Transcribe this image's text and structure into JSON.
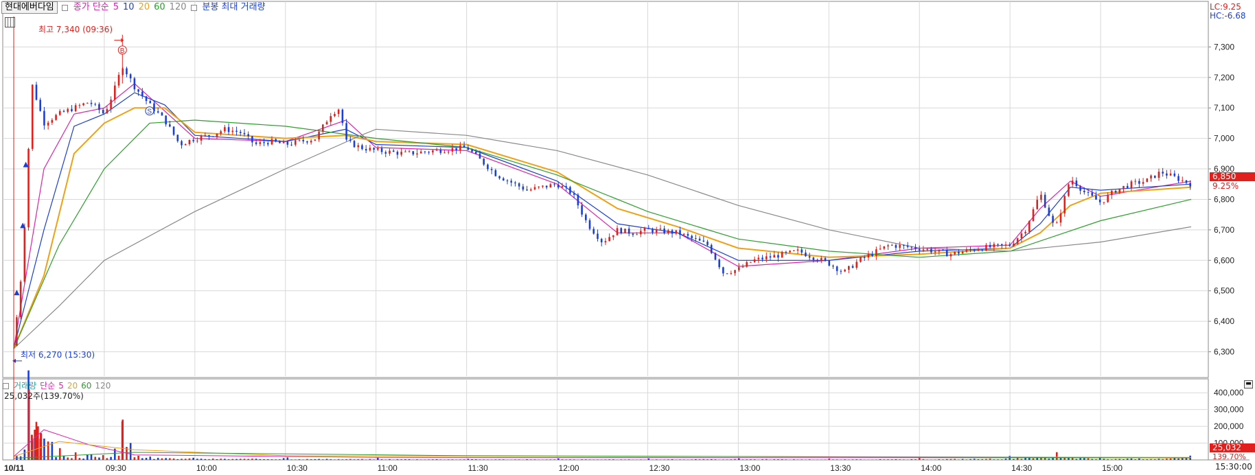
{
  "header": {
    "stock_name": "현대에버다임",
    "price_legend": {
      "label": "종가 단순",
      "ma": [
        "5",
        "10",
        "20",
        "60",
        "120"
      ]
    },
    "extra_legend": "분봉 최대 거래량",
    "lc": "LC:9.25",
    "hc": "HC:-6.68"
  },
  "annotations": {
    "high": "최고 7,340 (09:36)",
    "low": "최저 6,270 (15:30)",
    "buy_mark": "B",
    "sell_mark": "S"
  },
  "volume_header": {
    "label": "거래량",
    "legend": "단순",
    "ma": [
      "5",
      "20",
      "60",
      "120"
    ],
    "current": "25,032주(139.70%)"
  },
  "right_panel": {
    "current_price": "6,850",
    "current_change": "9.25%",
    "current_volume": "25,032",
    "volume_ratio": "139.70%",
    "last_time": "15:30:00"
  },
  "colors": {
    "up": "#e0201c",
    "down": "#1a3ed8",
    "ma5": "#e020b0",
    "ma10": "#1a3ed8",
    "ma20": "#f0a010",
    "ma60": "#2aa02a",
    "ma120": "#888888"
  },
  "chart_data": [
    {
      "type": "line",
      "x_ticks": [
        "10/11",
        "09:30",
        "10:00",
        "10:30",
        "11:00",
        "11:30",
        "12:00",
        "12:30",
        "13:00",
        "13:30",
        "14:00",
        "14:30",
        "15:00"
      ],
      "y_ticks": [
        "7,300",
        "7,200",
        "7,100",
        "7,000",
        "6,900",
        "6,800",
        "6,700",
        "6,600",
        "6,500",
        "6,400",
        "6,300"
      ],
      "ylim": [
        6220,
        7400
      ],
      "series": [
        {
          "name": "종가",
          "x": [
            "09:00",
            "09:03",
            "09:06",
            "09:10",
            "09:15",
            "09:20",
            "09:25",
            "09:30",
            "09:33",
            "09:36",
            "09:40",
            "09:45",
            "09:50",
            "09:55",
            "10:00",
            "10:05",
            "10:10",
            "10:15",
            "10:20",
            "10:25",
            "10:30",
            "10:35",
            "10:40",
            "10:45",
            "10:48",
            "10:50",
            "10:55",
            "11:00",
            "11:10",
            "11:20",
            "11:30",
            "11:40",
            "11:50",
            "12:00",
            "12:05",
            "12:10",
            "12:15",
            "12:20",
            "12:25",
            "12:30",
            "12:40",
            "12:50",
            "12:55",
            "13:00",
            "13:05",
            "13:10",
            "13:20",
            "13:30",
            "13:35",
            "13:40",
            "13:50",
            "14:00",
            "14:10",
            "14:20",
            "14:30",
            "14:35",
            "14:40",
            "14:45",
            "14:50",
            "14:55",
            "15:00",
            "15:05",
            "15:10",
            "15:15",
            "15:20",
            "15:30"
          ],
          "values": [
            6320,
            6600,
            7180,
            7050,
            7080,
            7100,
            7120,
            7080,
            7150,
            7240,
            7170,
            7110,
            7060,
            6980,
            7000,
            7010,
            7030,
            7020,
            6980,
            6990,
            6980,
            6990,
            7000,
            7080,
            7100,
            6990,
            6970,
            6960,
            6950,
            6960,
            6970,
            6880,
            6830,
            6850,
            6820,
            6720,
            6660,
            6700,
            6690,
            6700,
            6690,
            6650,
            6560,
            6570,
            6600,
            6610,
            6630,
            6590,
            6560,
            6600,
            6650,
            6640,
            6620,
            6640,
            6650,
            6700,
            6820,
            6700,
            6870,
            6820,
            6790,
            6830,
            6850,
            6860,
            6890,
            6850
          ]
        },
        {
          "name": "5",
          "x": [
            "09:00",
            "09:10",
            "09:20",
            "09:30",
            "09:40",
            "09:50",
            "10:00",
            "10:30",
            "10:50",
            "11:00",
            "11:30",
            "12:00",
            "12:20",
            "12:40",
            "13:00",
            "13:30",
            "14:00",
            "14:30",
            "14:40",
            "14:50",
            "15:00",
            "15:30"
          ],
          "values": [
            6310,
            6900,
            7080,
            7100,
            7180,
            7090,
            7000,
            6990,
            7060,
            6970,
            6960,
            6850,
            6690,
            6690,
            6580,
            6600,
            6640,
            6650,
            6770,
            6860,
            6810,
            6860
          ]
        },
        {
          "name": "10",
          "x": [
            "09:00",
            "09:10",
            "09:20",
            "09:30",
            "09:40",
            "09:50",
            "10:00",
            "10:30",
            "10:50",
            "11:00",
            "11:30",
            "12:00",
            "12:20",
            "12:40",
            "13:00",
            "13:30",
            "14:00",
            "14:30",
            "14:40",
            "14:50",
            "15:00",
            "15:30"
          ],
          "values": [
            6310,
            6700,
            7040,
            7080,
            7150,
            7110,
            7010,
            6990,
            7030,
            6980,
            6970,
            6860,
            6720,
            6690,
            6600,
            6600,
            6630,
            6640,
            6720,
            6840,
            6830,
            6850
          ]
        },
        {
          "name": "20",
          "x": [
            "09:00",
            "09:10",
            "09:20",
            "09:30",
            "09:40",
            "09:50",
            "10:00",
            "10:30",
            "10:50",
            "11:00",
            "11:30",
            "12:00",
            "12:20",
            "12:40",
            "13:00",
            "13:30",
            "14:00",
            "14:30",
            "14:40",
            "14:50",
            "15:00",
            "15:30"
          ],
          "values": [
            6310,
            6550,
            6950,
            7050,
            7100,
            7100,
            7020,
            7000,
            7010,
            6990,
            6980,
            6890,
            6770,
            6710,
            6640,
            6610,
            6620,
            6640,
            6690,
            6780,
            6820,
            6840
          ]
        },
        {
          "name": "60",
          "x": [
            "09:00",
            "09:15",
            "09:30",
            "09:45",
            "10:00",
            "10:30",
            "11:00",
            "11:30",
            "12:00",
            "12:30",
            "13:00",
            "13:30",
            "14:00",
            "14:30",
            "14:45",
            "15:00",
            "15:30"
          ],
          "values": [
            6310,
            6650,
            6900,
            7050,
            7060,
            7040,
            7000,
            6970,
            6880,
            6760,
            6670,
            6630,
            6610,
            6630,
            6680,
            6730,
            6800
          ]
        },
        {
          "name": "120",
          "x": [
            "09:00",
            "09:15",
            "09:30",
            "10:00",
            "10:30",
            "10:55",
            "11:00",
            "11:30",
            "12:00",
            "12:30",
            "13:00",
            "13:30",
            "14:00",
            "14:30",
            "15:00",
            "15:30"
          ],
          "values": [
            6310,
            6450,
            6600,
            6760,
            6900,
            7010,
            7030,
            7010,
            6960,
            6880,
            6780,
            6700,
            6640,
            6630,
            6660,
            6710
          ]
        }
      ]
    },
    {
      "type": "bar",
      "ylim": [
        0,
        450000
      ],
      "y_ticks": [
        "400,000",
        "300,000",
        "200,000",
        "100,000"
      ],
      "series": [
        {
          "name": "거래량",
          "x": [
            "09:01",
            "09:03",
            "09:04",
            "09:05",
            "09:06",
            "09:07",
            "09:08",
            "09:09",
            "09:10",
            "09:12",
            "09:15",
            "09:20",
            "09:25",
            "09:30",
            "09:34",
            "09:36",
            "09:38",
            "09:45",
            "10:00",
            "10:30",
            "11:00",
            "11:30",
            "12:00",
            "12:30",
            "13:00",
            "13:30",
            "14:00",
            "14:30",
            "14:45",
            "15:00",
            "15:30"
          ],
          "values": [
            30000,
            60000,
            80000,
            420000,
            150000,
            180000,
            200000,
            160000,
            120000,
            90000,
            60000,
            50000,
            40000,
            45000,
            60000,
            230000,
            80000,
            30000,
            20000,
            15000,
            12000,
            10000,
            8000,
            8000,
            12000,
            8000,
            10000,
            20000,
            40000,
            15000,
            25032
          ]
        }
      ]
    }
  ]
}
